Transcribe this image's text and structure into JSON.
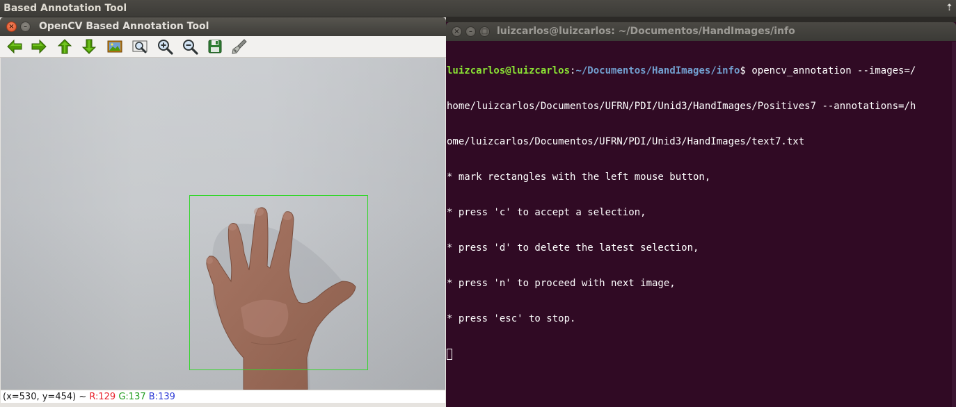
{
  "desktop": {
    "active_app_title": "' Based Annotation Tool",
    "tray_icon": "up-arrow-icon"
  },
  "opencv_window": {
    "title": "OpenCV Based Annotation Tool",
    "close_glyph": "×",
    "minimize_glyph": "–",
    "toolbar": [
      {
        "name": "pan-left",
        "icon": "arrow-left-icon"
      },
      {
        "name": "pan-right",
        "icon": "arrow-right-icon"
      },
      {
        "name": "pan-up",
        "icon": "arrow-up-icon"
      },
      {
        "name": "pan-down",
        "icon": "arrow-down-icon"
      },
      {
        "name": "zoom-reset",
        "icon": "image-icon"
      },
      {
        "name": "zoom-selection",
        "icon": "zoom-fit-icon"
      },
      {
        "name": "zoom-in",
        "icon": "zoom-in-icon"
      },
      {
        "name": "zoom-out",
        "icon": "zoom-out-icon"
      },
      {
        "name": "save-image",
        "icon": "save-icon"
      },
      {
        "name": "properties",
        "icon": "brush-icon"
      }
    ],
    "status": {
      "coords": "(x=530, y=454) ~",
      "r": "R:129",
      "g": "G:137",
      "b": "B:139"
    },
    "colors": {
      "selection_rect": "#33d62b",
      "arrow_green": "#4e9a06"
    }
  },
  "terminal": {
    "title": "luizcarlos@luizcarlos: ~/Documentos/HandImages/info",
    "prompt_user": "luizcarlos@luizcarlos",
    "prompt_sep": ":",
    "prompt_path": "~/Documentos/HandImages/info",
    "prompt_symbol": "$",
    "command_part1": " opencv_annotation --images=/",
    "command_part2": "home/luizcarlos/Documentos/UFRN/PDI/Unid3/HandImages/Positives7 --annotations=/h",
    "command_part3": "ome/luizcarlos/Documentos/UFRN/PDI/Unid3/HandImages/text7.txt",
    "output": [
      "* mark rectangles with the left mouse button,",
      "* press 'c' to accept a selection,",
      "* press 'd' to delete the latest selection,",
      "* press 'n' to proceed with next image,",
      "* press 'esc' to stop."
    ],
    "colors": {
      "background": "#300a24",
      "prompt_user": "#8ae234",
      "prompt_path": "#729fcf"
    }
  }
}
